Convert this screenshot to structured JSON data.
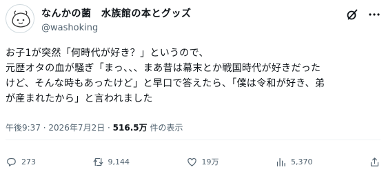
{
  "user": {
    "display_name": "なんかの菌　水族館の本とグッズ",
    "handle": "@washoking"
  },
  "header_icons": [
    "grok-icon",
    "more-icon"
  ],
  "tweet": {
    "lines": [
      "お子1が突然「何時代が好き？」というので、",
      "元歴オタの血が騒ぎ「まっ、、、まあ昔は幕末とか戦国時代が好きだった",
      "けど、そんな時もあったけど」と早口で答えたら、「僕は令和が好き、弟",
      "が産まれたから」と言われました"
    ]
  },
  "meta": {
    "timestamp": "午後9:37 · 2026年7月2日 · ",
    "views_count": "516.5万",
    "views_label": " 件の表示"
  },
  "actions": {
    "reply": {
      "icon": "reply-icon",
      "count": "273"
    },
    "repost": {
      "icon": "repost-icon",
      "count": "9,144"
    },
    "like": {
      "icon": "like-icon",
      "count": "19万"
    },
    "views": {
      "icon": "views-icon",
      "count": "5,370"
    },
    "share": {
      "icon": "share-icon",
      "count": ""
    }
  },
  "colors": {
    "text_primary": "#0f1419",
    "text_secondary": "#536471",
    "divider": "#eff3f4"
  }
}
